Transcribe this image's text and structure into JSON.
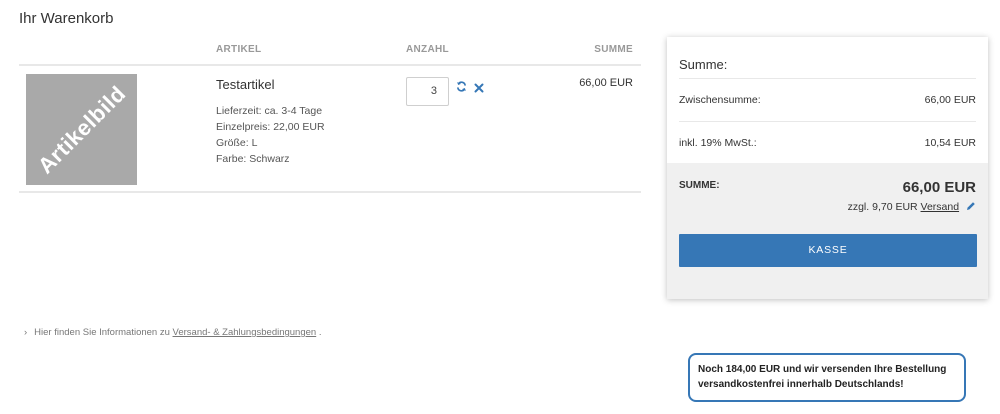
{
  "page": {
    "title": "Ihr Warenkorb"
  },
  "cart": {
    "headers": {
      "artikel": "ARTIKEL",
      "anzahl": "ANZAHL",
      "summe": "SUMME"
    },
    "item": {
      "image_text": "Artikelbild",
      "name": "Testartikel",
      "delivery": "Lieferzeit: ca. 3-4 Tage",
      "unit_price": "Einzelpreis: 22,00 EUR",
      "size": "Größe: L",
      "color": "Farbe: Schwarz",
      "quantity": "3",
      "total": "66,00 EUR",
      "icons": {
        "refresh": "refresh-icon",
        "remove": "close-icon"
      }
    }
  },
  "info": {
    "chevron": "›",
    "text": "Hier finden Sie Informationen zu",
    "link": "Versand- & Zahlungsbedingungen",
    "suffix": "."
  },
  "summary": {
    "title": "Summe:",
    "subtotal_label": "Zwischensumme:",
    "subtotal_value": "66,00 EUR",
    "vat_label": "inkl. 19% MwSt.:",
    "vat_value": "10,54 EUR",
    "total_label": "SUMME:",
    "total_value": "66,00 EUR",
    "shipping_prefix": "zzgl. 9,70 EUR",
    "shipping_link": "Versand",
    "checkout_label": "KASSE",
    "accent_color": "#3677b6"
  },
  "free_shipping": {
    "line1": "Noch 184,00 EUR und wir versenden Ihre Bestellung",
    "line2": "versandkostenfrei innerhalb Deutschlands!"
  }
}
